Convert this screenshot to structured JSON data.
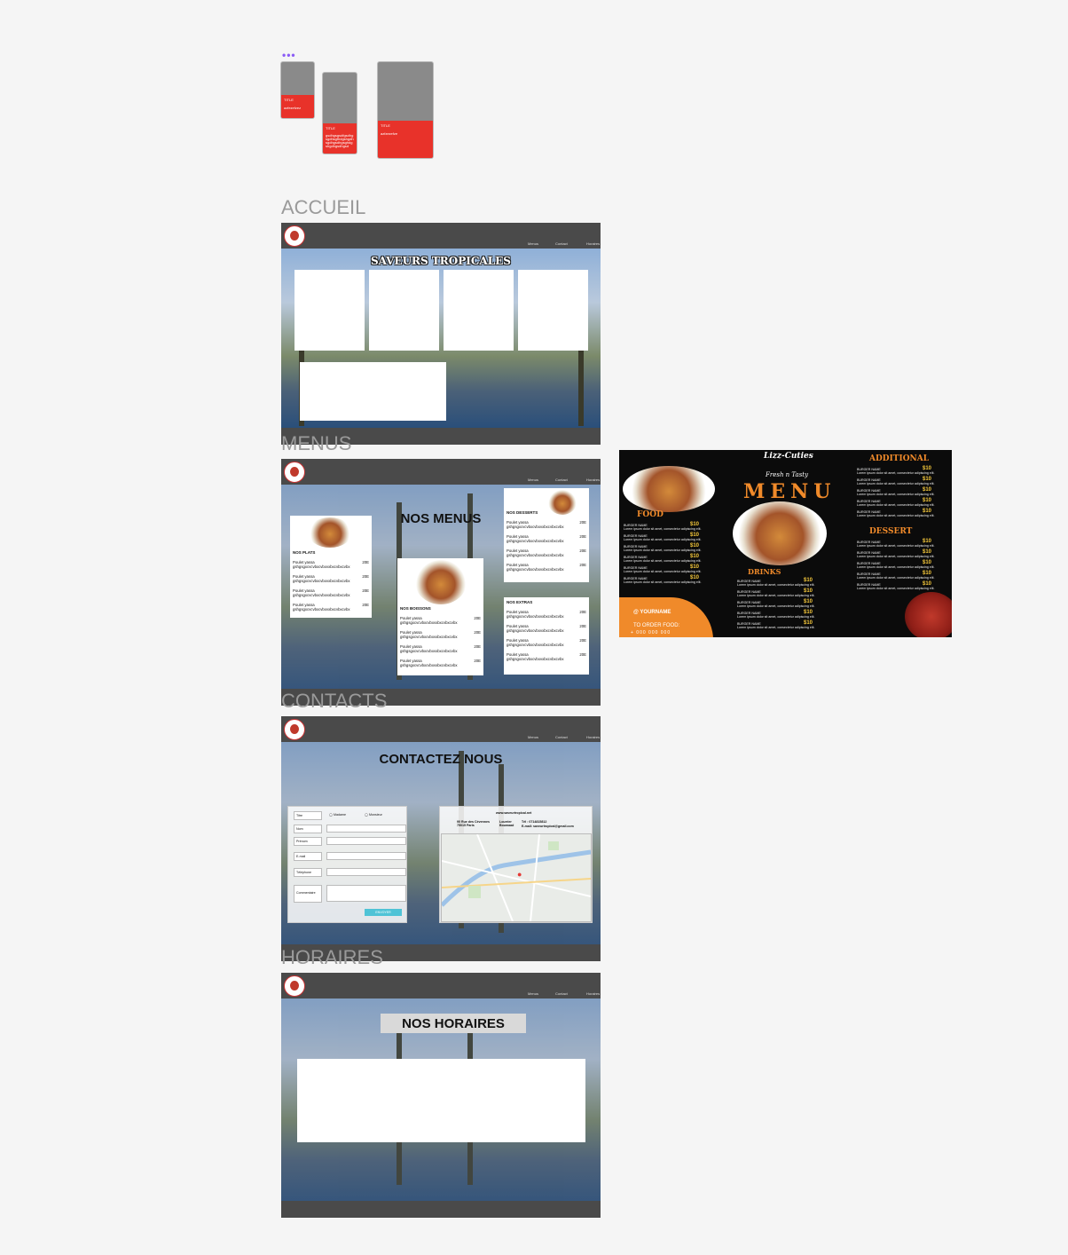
{
  "dots": "•••",
  "cards": [
    {
      "title": "TITLE",
      "text": "azfezefzez"
    },
    {
      "title": "TITLE",
      "text": "gsdhgsgsdfgsdhgsgdhsgfhdgshgdhsgdhgsdhgsghdgshgdhgsdhgsd"
    },
    {
      "title": "TITLE",
      "text": "azfzezefze"
    }
  ],
  "sections": {
    "accueil": "ACCUEIL",
    "menus": "MENUS",
    "contacts": "CONTACTS",
    "horaires": "HORAIRES"
  },
  "nav": {
    "menus": "Menus",
    "contact": "Contact",
    "horaires": "Horaires"
  },
  "accueil": {
    "title": "SAVEURS TROPICALES"
  },
  "menus": {
    "title": "NOS MENUS",
    "plats": {
      "heading": "NOS PLATS",
      "items": [
        {
          "name": "Poulet yassa gshgsgxcvcvbxcvbxvxbxcvbxcvbx",
          "price": "20E"
        },
        {
          "name": "Poulet yassa gshgsgxcvcvbxcvbxvxbxcvbxcvbx",
          "price": "20E"
        },
        {
          "name": "Poulet yassa gshgsgxcvcvbxcvbxvxbxcvbxcvbx",
          "price": "20E"
        },
        {
          "name": "Poulet yassa gshgsgxcvcvbxcvbxvxbxcvbxcvbx",
          "price": "20E"
        }
      ]
    },
    "boissons": {
      "heading": "NOS BOISSONS",
      "items": [
        {
          "name": "Poulet yassa gshgsgxcvcvbxcvbxvxbxcvbxcvbx",
          "price": "20E"
        },
        {
          "name": "Poulet yassa gshgsgxcvcvbxcvbxvxbxcvbxcvbx",
          "price": "20E"
        },
        {
          "name": "Poulet yassa gshgsgxcvcvbxcvbxvxbxcvbxcvbx",
          "price": "20E"
        },
        {
          "name": "Poulet yassa gshgsgxcvcvbxcvbxvxbxcvbxcvbx",
          "price": "20E"
        }
      ]
    },
    "desserts": {
      "heading": "NOS DESSERTS",
      "items": [
        {
          "name": "Poulet yassa gshgsgxcvcvbxcvbxvxbxcvbxcvbx",
          "price": "20E"
        },
        {
          "name": "Poulet yassa gshgsgxcvcvbxcvbxvxbxcvbxcvbx",
          "price": "20E"
        },
        {
          "name": "Poulet yassa gshgsgxcvcvbxcvbxvxbxcvbxcvbx",
          "price": "20E"
        },
        {
          "name": "Poulet yassa gshgsgxcvcvbxcvbxvxbxcvbxcvbx",
          "price": "20E"
        }
      ]
    },
    "extras": {
      "heading": "NOS EXTRAS",
      "items": [
        {
          "name": "Poulet yassa gshgsgxcvcvbxcvbxvxbxcvbxcvbx",
          "price": "20E"
        },
        {
          "name": "Poulet yassa gshgsgxcvcvbxcvbxvxbxcvbxcvbx",
          "price": "20E"
        },
        {
          "name": "Poulet yassa gshgsgxcvcvbxcvbxvxbxcvbxcvbx",
          "price": "20E"
        },
        {
          "name": "Poulet yassa gshgsgxcvcvbxcvbxvxbxcvbxcvbx",
          "price": "20E"
        }
      ]
    }
  },
  "contact": {
    "title": "CONTACTEZ NOUS",
    "form": {
      "civility": "Titre",
      "madame": "Madame",
      "monsieur": "Monsieur",
      "nom": "Nom",
      "prenom": "Prénom",
      "email": "E-mail",
      "telephone": "Téléphone",
      "commentaire": "Commentaire",
      "submit": "ENVOYER"
    },
    "info": {
      "website": "www.saveurtropical.net",
      "address": "90 Rue des Cévennes 75015 Paris",
      "hours_label": "Lourrier Boumaad",
      "phone": "Tél : 0714815812",
      "email": "E-mail: saveurtropical@gmail.com"
    }
  },
  "horaires": {
    "title": "NOS HORAIRES"
  },
  "poster": {
    "brand": "Lizz-Cuties",
    "tagline": "Fresh n Tasty",
    "menu": "MENU",
    "food": "FOOD",
    "drinks": "DRINKS",
    "additional": "ADDITIONAL",
    "dessert": "DESSERT",
    "item_name": "BURGER NAME",
    "item_desc": "Lorem ipsum dolor sit amet, consectetur adipiscing elit.",
    "price": "$10",
    "social": "@ YOURNAME",
    "order": "TO ORDER FOOD:",
    "order_phone": "+ 000 000 000"
  }
}
